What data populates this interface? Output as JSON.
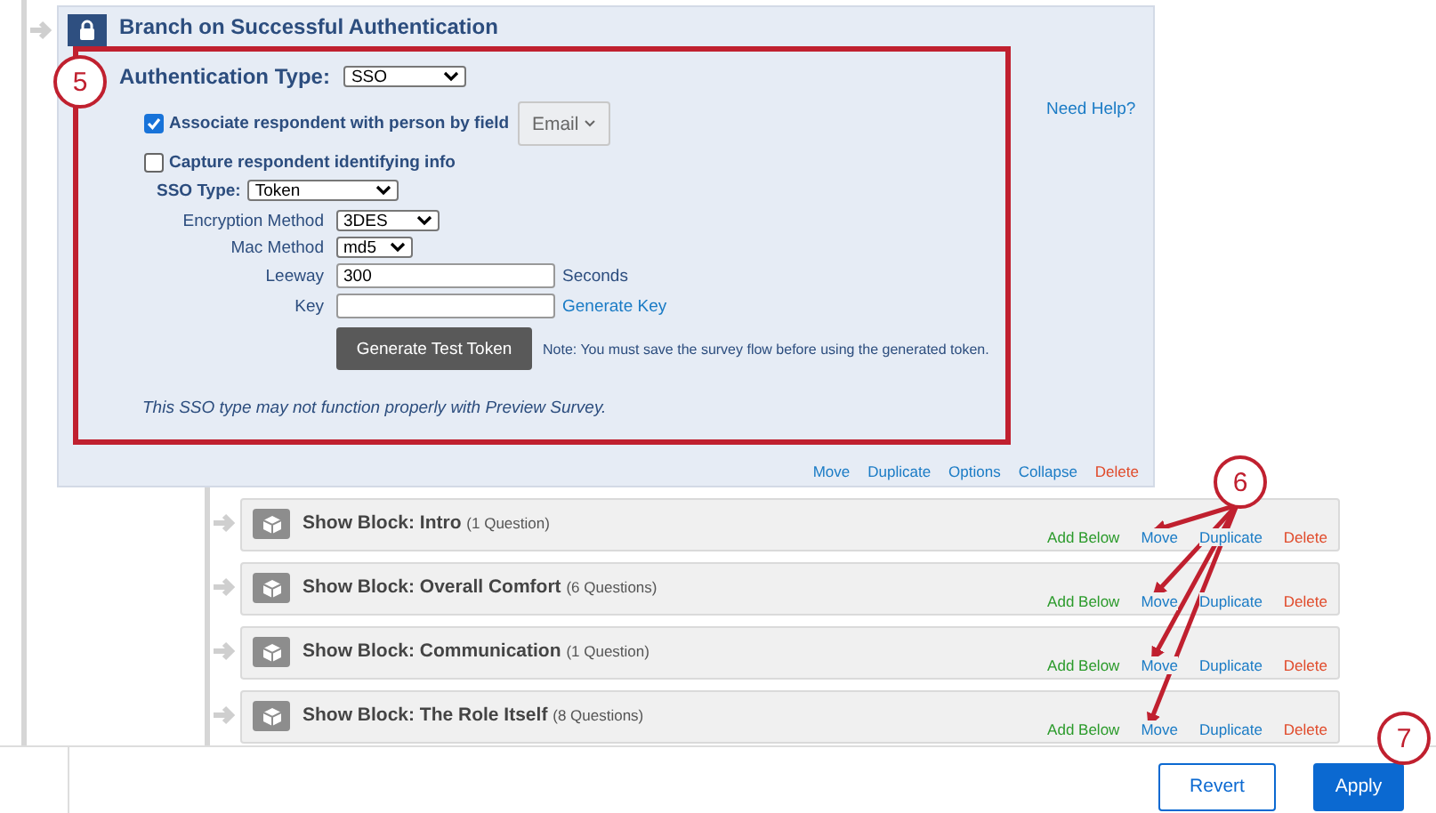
{
  "branch": {
    "title": "Branch on Successful Authentication",
    "auth_type": {
      "label": "Authentication Type:",
      "value": "SSO"
    },
    "associate": {
      "label": "Associate respondent with person by field",
      "checked": true,
      "field": "Email"
    },
    "capture": {
      "label": "Capture respondent identifying info",
      "checked": false
    },
    "sso_type": {
      "label": "SSO Type:",
      "value": "Token"
    },
    "fields": [
      {
        "kind": "select",
        "label": "Encryption Method",
        "value": "3DES"
      },
      {
        "kind": "select",
        "label": "Mac Method",
        "value": "md5"
      },
      {
        "kind": "input",
        "label": "Leeway",
        "value": "300",
        "suffix": "Seconds"
      },
      {
        "kind": "input",
        "label": "Key",
        "link": "Generate Key"
      }
    ],
    "test_button": "Generate Test Token",
    "note": "Note: You must save the survey flow before using the generated token.",
    "warning": "This SSO type may not function properly with Preview Survey.",
    "help_link": "Need Help?",
    "actions": [
      {
        "label": "Move",
        "kind": "link"
      },
      {
        "label": "Duplicate",
        "kind": "link"
      },
      {
        "label": "Options",
        "kind": "link"
      },
      {
        "label": "Collapse",
        "kind": "link"
      },
      {
        "label": "Delete",
        "kind": "delete"
      }
    ]
  },
  "blocks": [
    {
      "title": "Show Block: Intro",
      "count": "(1 Question)",
      "actions": [
        {
          "label": "Add Below",
          "kind": "add"
        },
        {
          "label": "Move",
          "kind": "link"
        },
        {
          "label": "Duplicate",
          "kind": "link"
        },
        {
          "label": "Delete",
          "kind": "delete"
        }
      ]
    },
    {
      "title": "Show Block: Overall Comfort",
      "count": "(6 Questions)",
      "actions": [
        {
          "label": "Add Below",
          "kind": "add"
        },
        {
          "label": "Move",
          "kind": "link"
        },
        {
          "label": "Duplicate",
          "kind": "link"
        },
        {
          "label": "Delete",
          "kind": "delete"
        }
      ]
    },
    {
      "title": "Show Block: Communication",
      "count": "(1 Question)",
      "actions": [
        {
          "label": "Add Below",
          "kind": "add"
        },
        {
          "label": "Move",
          "kind": "link"
        },
        {
          "label": "Duplicate",
          "kind": "link"
        },
        {
          "label": "Delete",
          "kind": "delete"
        }
      ]
    },
    {
      "title": "Show Block: The Role Itself",
      "count": "(8 Questions)",
      "actions": [
        {
          "label": "Add Below",
          "kind": "add"
        },
        {
          "label": "Move",
          "kind": "link"
        },
        {
          "label": "Duplicate",
          "kind": "link"
        },
        {
          "label": "Delete",
          "kind": "delete"
        }
      ]
    }
  ],
  "footer": {
    "buttons": [
      {
        "label": "Revert",
        "kind": "secondary"
      },
      {
        "label": "Apply",
        "kind": "primary"
      }
    ]
  },
  "callouts": [
    "5",
    "6",
    "7"
  ]
}
